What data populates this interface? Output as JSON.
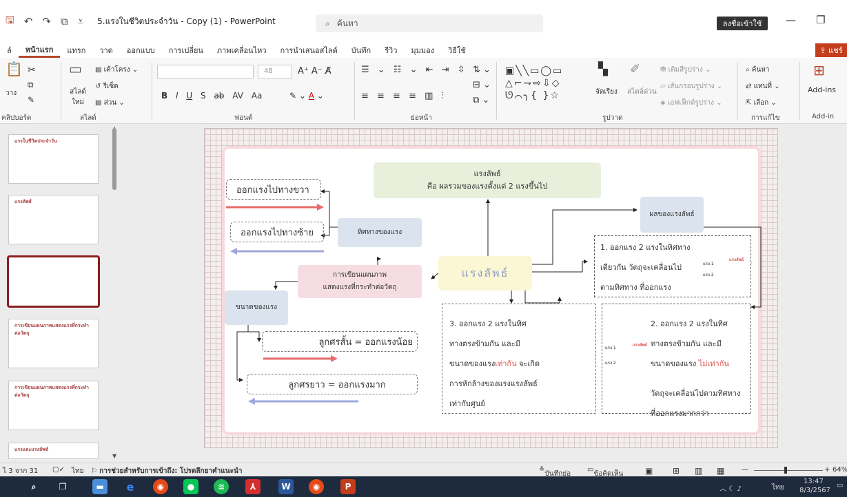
{
  "window": {
    "doc_title": "5.แรงในชีวิตประจำวัน - Copy (1) - PowerPoint",
    "search_placeholder": "ค้นหา",
    "signin": "ลงชื่อเข้าใช้",
    "share": "แชร์"
  },
  "tabs": [
    "ล์",
    "หน้าแรก",
    "แทรก",
    "วาด",
    "ออกแบบ",
    "การเปลี่ยน",
    "ภาพเคลื่อนไหว",
    "การนำเสนอสไลด์",
    "บันทึก",
    "รีวิว",
    "มุมมอง",
    "วิธีใช้"
  ],
  "ribbon": {
    "clipboard": {
      "paste": "วาง",
      "label": "คลิปบอร์ด"
    },
    "slides": {
      "new_slide": "สไลด์ใหม่",
      "layout": "เค้าโครง",
      "reset": "รีเซ็ต",
      "section": "ส่วน",
      "label": "สไลด์"
    },
    "font": {
      "size": "48",
      "label": "ฟอนต์",
      "fmt_buttons": [
        "B",
        "I",
        "U",
        "S",
        "ab",
        "AV",
        "Aa"
      ]
    },
    "paragraph": {
      "label": "ย่อหน้า"
    },
    "drawing": {
      "arrange": "จัดเรียง",
      "quick_styles": "สไตล์ด่วน",
      "fill": "เติมสีรูปร่าง",
      "outline": "เส้นกรอบรูปร่าง",
      "effects": "เอฟเฟ็กต์รูปร่าง",
      "label": "รูปวาด"
    },
    "editing": {
      "find": "ค้นหา",
      "replace": "แทนที่",
      "select": "เลือก",
      "label": "การแก้ไข"
    },
    "addins": {
      "button": "Add-ins",
      "label": "Add-in"
    }
  },
  "thumbs": [
    {
      "title": "แรงในชีวิตประจำวัน"
    },
    {
      "title": "แรงลัพธ์"
    },
    {
      "title": ""
    },
    {
      "title": "การเขียนแผนภาพแสดงแรงที่กระทำต่อวัตถุ"
    },
    {
      "title": "การเขียนแผนภาพแสดงแรงที่กระทำต่อวัตถุ"
    },
    {
      "title": "แรงและแรงลัพธ์"
    }
  ],
  "slide": {
    "top_box": [
      "แรงลัพธ์",
      "คือ ผลรวมของแรงตั้งแต่ 2 แรงขึ้นไป"
    ],
    "direction_box": "ทิศทางของแรง",
    "diagram_box": [
      "การเขียนแผนภาพ",
      "แสดงแรงที่กระทำต่อวัตถุ"
    ],
    "center": "แรงลัพธ์",
    "size_box": "ขนาดของแรง",
    "result_box": "ผลของแรงลัพธ์",
    "right_label": "ออกแรงไปทางขวา",
    "left_label": "ออกแรงไปทางซ้าย",
    "short_arrow": "ลูกศรสั้น = ออกแรงน้อย",
    "long_arrow": "ลูกศรยาว = ออกแรงมาก",
    "case1": [
      "1. ออกแรง 2 แรงในทิศทาง",
      "เดียวกัน วัตถุจะเคลื่อนไป",
      "ตามทิศทาง ที่ออกแรง"
    ],
    "case2": [
      "2. ออกแรง 2 แรงในทิศ",
      "ทางตรงข้ามกัน และมี",
      "ขนาดของแรง",
      "ไม่เท่ากัน",
      "วัตถุจะเคลื่อนไปตามทิศทาง",
      "ที่ออกแรงมากกว่า"
    ],
    "case3": [
      "3. ออกแรง 2 แรงในทิศ",
      "ทางตรงข้ามกัน และมี",
      "ขนาดของแรง",
      "เท่ากัน",
      "จะเกิด",
      "การหักล้างของแรงแรงลัพธ์",
      "เท่ากับศูนย์"
    ],
    "force1": "แรง 1",
    "force2": "แรง 2",
    "net": "แรงลัพธ์"
  },
  "status": {
    "slide_num": "ไ 3 จาก 31",
    "lang": "ไทย",
    "accessibility": "การช่วยสำหรับการเข้าถึง: โปรดลึกยาคำแนะนำ",
    "notes": "บันทึกย่อ",
    "comments": "ข้อคิดเห็น",
    "zoom": "64%"
  },
  "taskbar": {
    "time": "13:47",
    "date": "8/3/2567",
    "lang": "ไทย"
  },
  "colors": {
    "accent": "#b7472a",
    "red_arrow": "#e86a6a",
    "blue_arrow": "#9fa8db"
  }
}
